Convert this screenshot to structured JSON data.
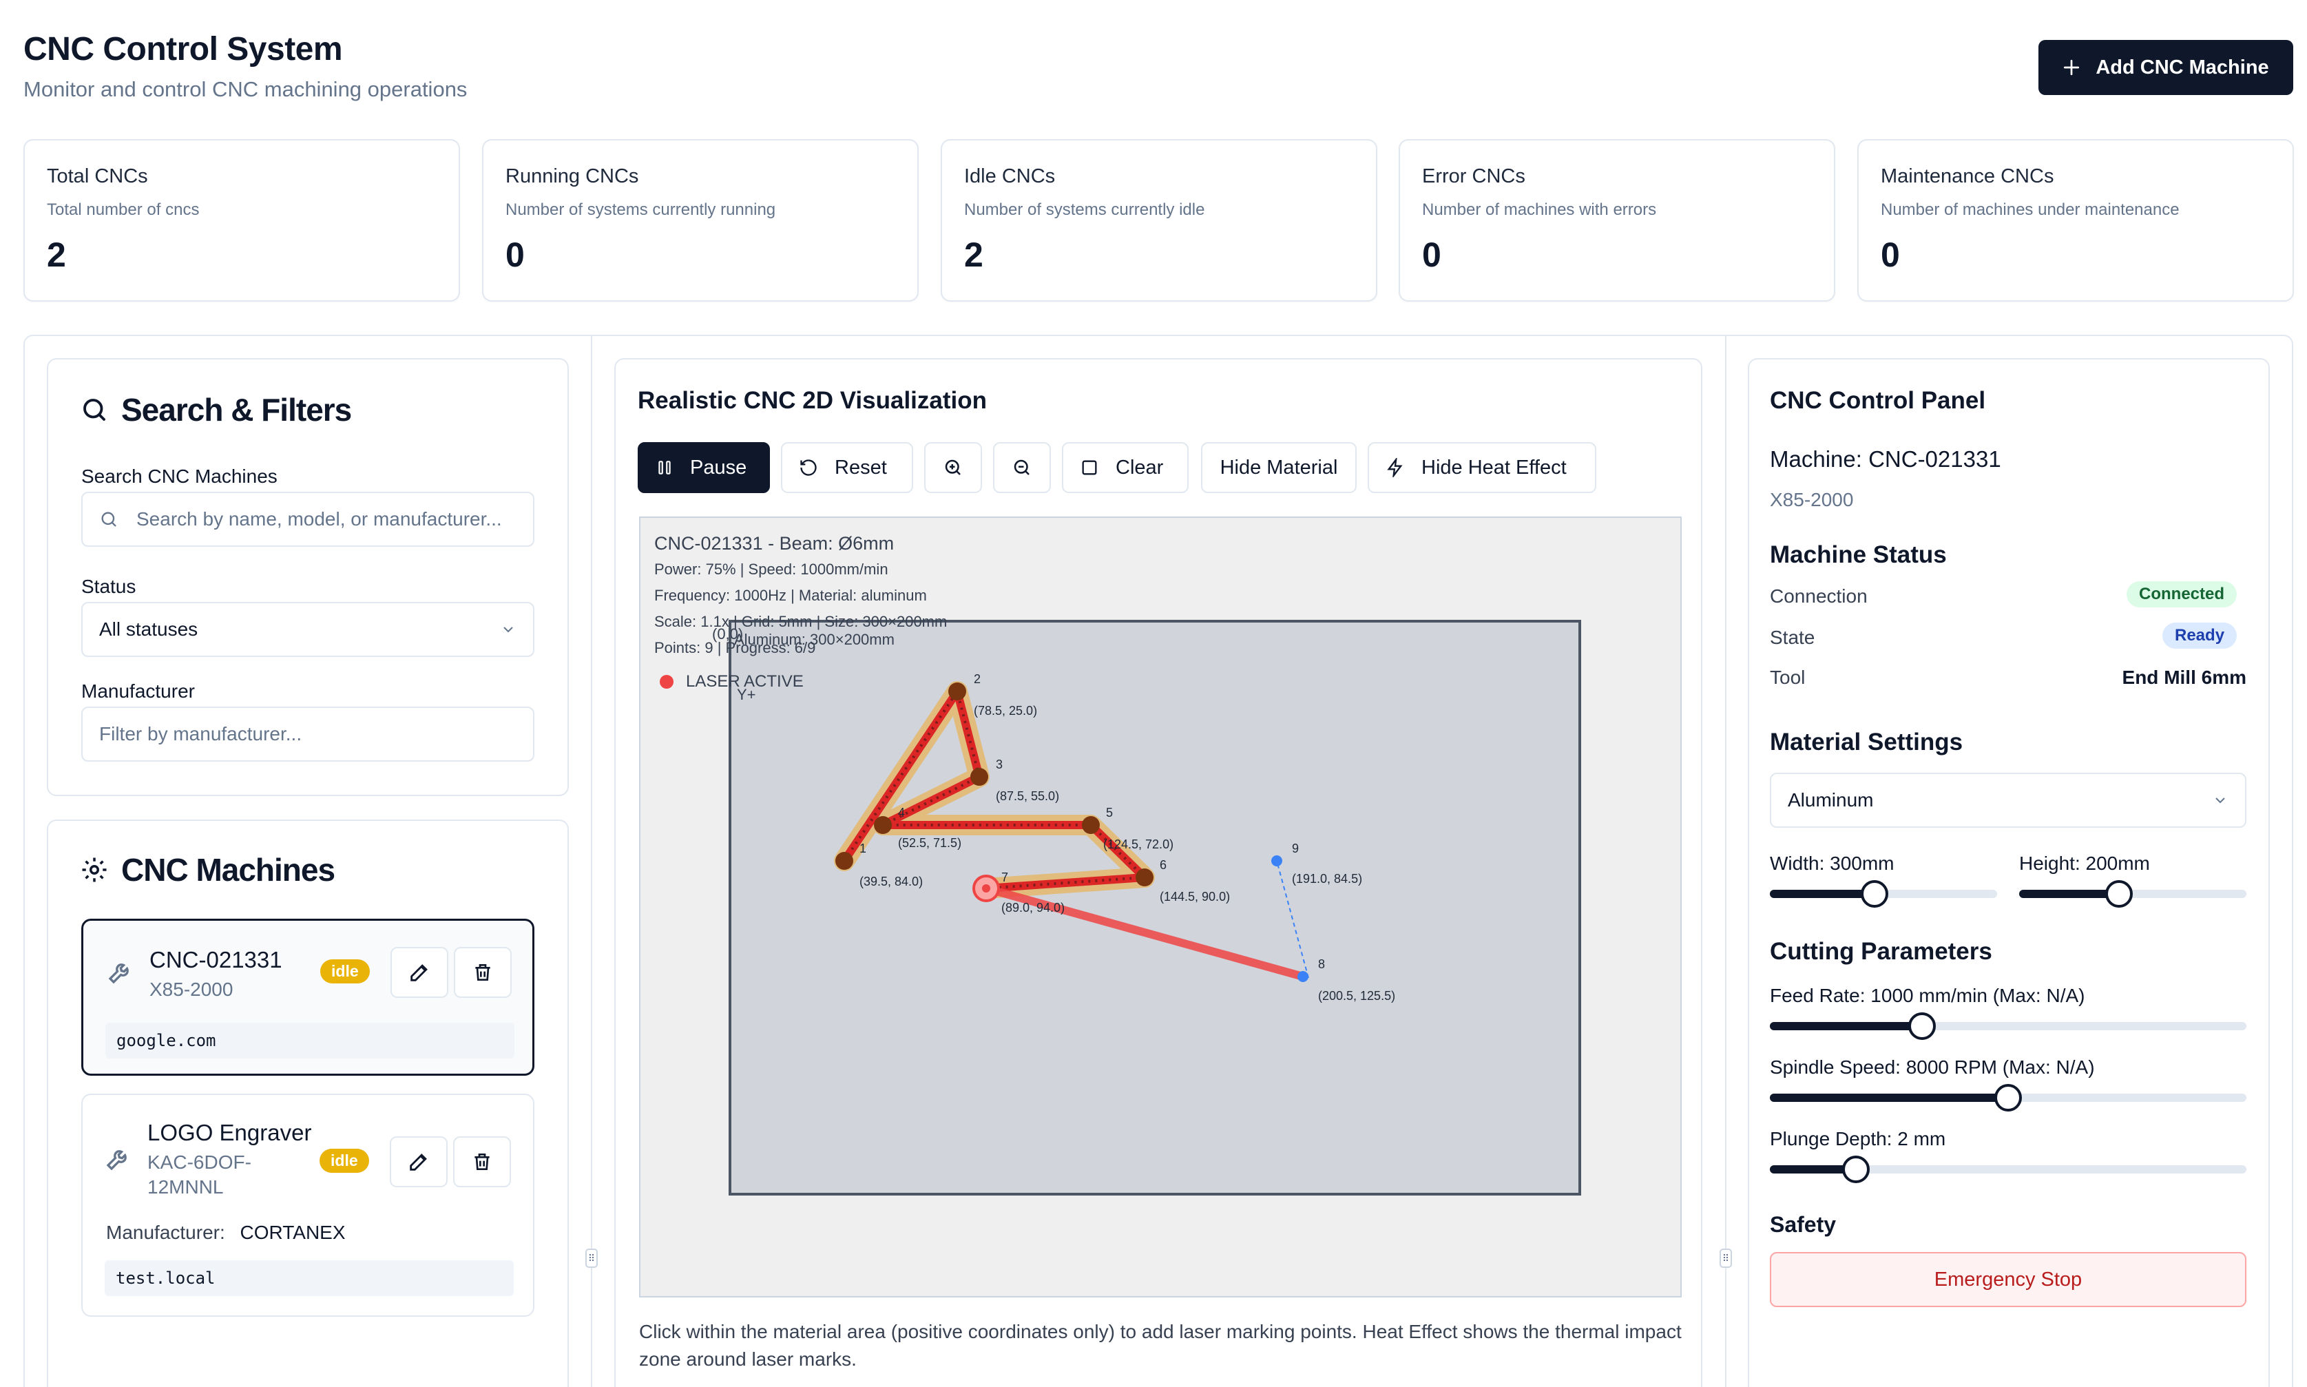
{
  "header": {
    "title": "CNC Control System",
    "subtitle": "Monitor and control CNC machining operations",
    "add_button": "Add CNC Machine"
  },
  "stats": [
    {
      "title": "Total CNCs",
      "desc": "Total number of cncs",
      "value": "2"
    },
    {
      "title": "Running CNCs",
      "desc": "Number of systems currently running",
      "value": "0"
    },
    {
      "title": "Idle CNCs",
      "desc": "Number of systems currently idle",
      "value": "2"
    },
    {
      "title": "Error CNCs",
      "desc": "Number of machines with errors",
      "value": "0"
    },
    {
      "title": "Maintenance CNCs",
      "desc": "Number of machines under maintenance",
      "value": "0"
    }
  ],
  "filters": {
    "title": "Search & Filters",
    "search_label": "Search CNC Machines",
    "search_placeholder": "Search by name, model, or manufacturer...",
    "status_label": "Status",
    "status_value": "All statuses",
    "manufacturer_label": "Manufacturer",
    "manufacturer_placeholder": "Filter by manufacturer..."
  },
  "machines": {
    "title": "CNC Machines",
    "items": [
      {
        "name": "CNC-021331",
        "model": "X85-2000",
        "status": "idle",
        "host": "google.com"
      },
      {
        "name": "LOGO Engraver",
        "model_line1": "KAC-6DOF-",
        "model_line2": "12MNNL",
        "status": "idle",
        "manufacturer_label": "Manufacturer:",
        "manufacturer": "CORTANEX",
        "host": "test.local"
      }
    ]
  },
  "viz": {
    "title": "Realistic CNC 2D Visualization",
    "buttons": {
      "pause": "Pause",
      "reset": "Reset",
      "clear": "Clear",
      "hide_material": "Hide Material",
      "hide_heat": "Hide Heat Effect"
    },
    "info_title": "CNC-021331 - Beam: Ø6mm",
    "info_line1": "Power: 75% | Speed: 1000mm/min",
    "info_line2": "Frequency: 1000Hz | Material: aluminum",
    "info_line3": "Scale: 1.1x | Grid: 5mm | Size: 300×200mm",
    "info_line4": "Points: 9 | Progress: 6/9",
    "material_label": "Aluminum: 300×200mm",
    "origin_label": "(0,0)",
    "y_label": "Y+",
    "laser_label": "LASER ACTIVE",
    "points": [
      {
        "id": "1",
        "label": "(39.5, 84.0)"
      },
      {
        "id": "2",
        "label": "(78.5, 25.0)"
      },
      {
        "id": "3",
        "label": "(87.5, 55.0)"
      },
      {
        "id": "4",
        "label": "(52.5, 71.5)"
      },
      {
        "id": "5",
        "label": "(124.5, 72.0)"
      },
      {
        "id": "6",
        "label": "(144.5, 90.0)"
      },
      {
        "id": "7",
        "label": "(89.0, 94.0)"
      },
      {
        "id": "8",
        "label": "(200.5, 125.5)"
      },
      {
        "id": "9",
        "label": "(191.0, 84.5)"
      }
    ],
    "help": "Click within the material area (positive coordinates only) to add laser marking points. Heat Effect shows the thermal impact zone around laser marks."
  },
  "control": {
    "title": "CNC Control Panel",
    "machine": "Machine: CNC-021331",
    "model": "X85-2000",
    "status_title": "Machine Status",
    "connection_label": "Connection",
    "connection_value": "Connected",
    "state_label": "State",
    "state_value": "Ready",
    "tool_label": "Tool",
    "tool_value": "End Mill 6mm",
    "material_title": "Material Settings",
    "material_value": "Aluminum",
    "width_label": "Width: 300mm",
    "height_label": "Height: 200mm",
    "width_level": 0.46,
    "height_level": 0.44,
    "cutting_title": "Cutting Parameters",
    "feed_label": "Feed Rate: 1000 mm/min (Max: N/A)",
    "feed_level": 0.32,
    "spindle_label": "Spindle Speed: 8000 RPM (Max: N/A)",
    "spindle_level": 0.5,
    "plunge_label": "Plunge Depth: 2 mm",
    "plunge_level": 0.18,
    "safety_title": "Safety",
    "estop": "Emergency Stop"
  }
}
